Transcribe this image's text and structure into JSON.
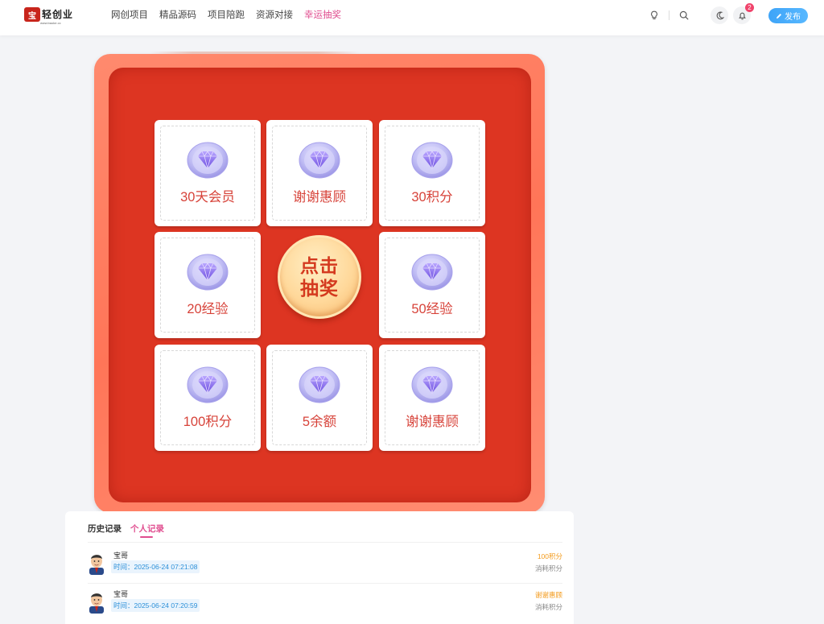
{
  "header": {
    "logo": {
      "mark": "宝",
      "text": "轻创业",
      "sub": "www.baoke.cc"
    },
    "nav": [
      {
        "label": "网创项目",
        "active": false
      },
      {
        "label": "精品源码",
        "active": false
      },
      {
        "label": "项目陪跑",
        "active": false
      },
      {
        "label": "资源对接",
        "active": false
      },
      {
        "label": "幸运抽奖",
        "active": true
      }
    ],
    "notification_count": "2",
    "publish_label": "发布"
  },
  "lottery": {
    "prizes": [
      {
        "label": "30天会员"
      },
      {
        "label": "谢谢惠顾"
      },
      {
        "label": "30积分"
      },
      {
        "label": "20经验"
      },
      {
        "label": "50经验"
      },
      {
        "label": "100积分"
      },
      {
        "label": "5余额"
      },
      {
        "label": "谢谢惠顾"
      }
    ],
    "draw_button": "点击抽奖"
  },
  "records": {
    "tabs": [
      {
        "label": "历史记录",
        "active": false
      },
      {
        "label": "个人记录",
        "active": true
      }
    ],
    "rows": [
      {
        "name": "宝哥",
        "time": "时间：2025-06-24 07:21:08",
        "prize": "100积分",
        "cost": "消耗积分"
      },
      {
        "name": "宝哥",
        "time": "时间：2025-06-24 07:20:59",
        "prize": "谢谢惠顾",
        "cost": "消耗积分"
      }
    ]
  },
  "colors": {
    "accent": "#e04d8f",
    "board": "#dd3522",
    "publish": "#3ea4f8",
    "prize_text": "#d7433a"
  }
}
